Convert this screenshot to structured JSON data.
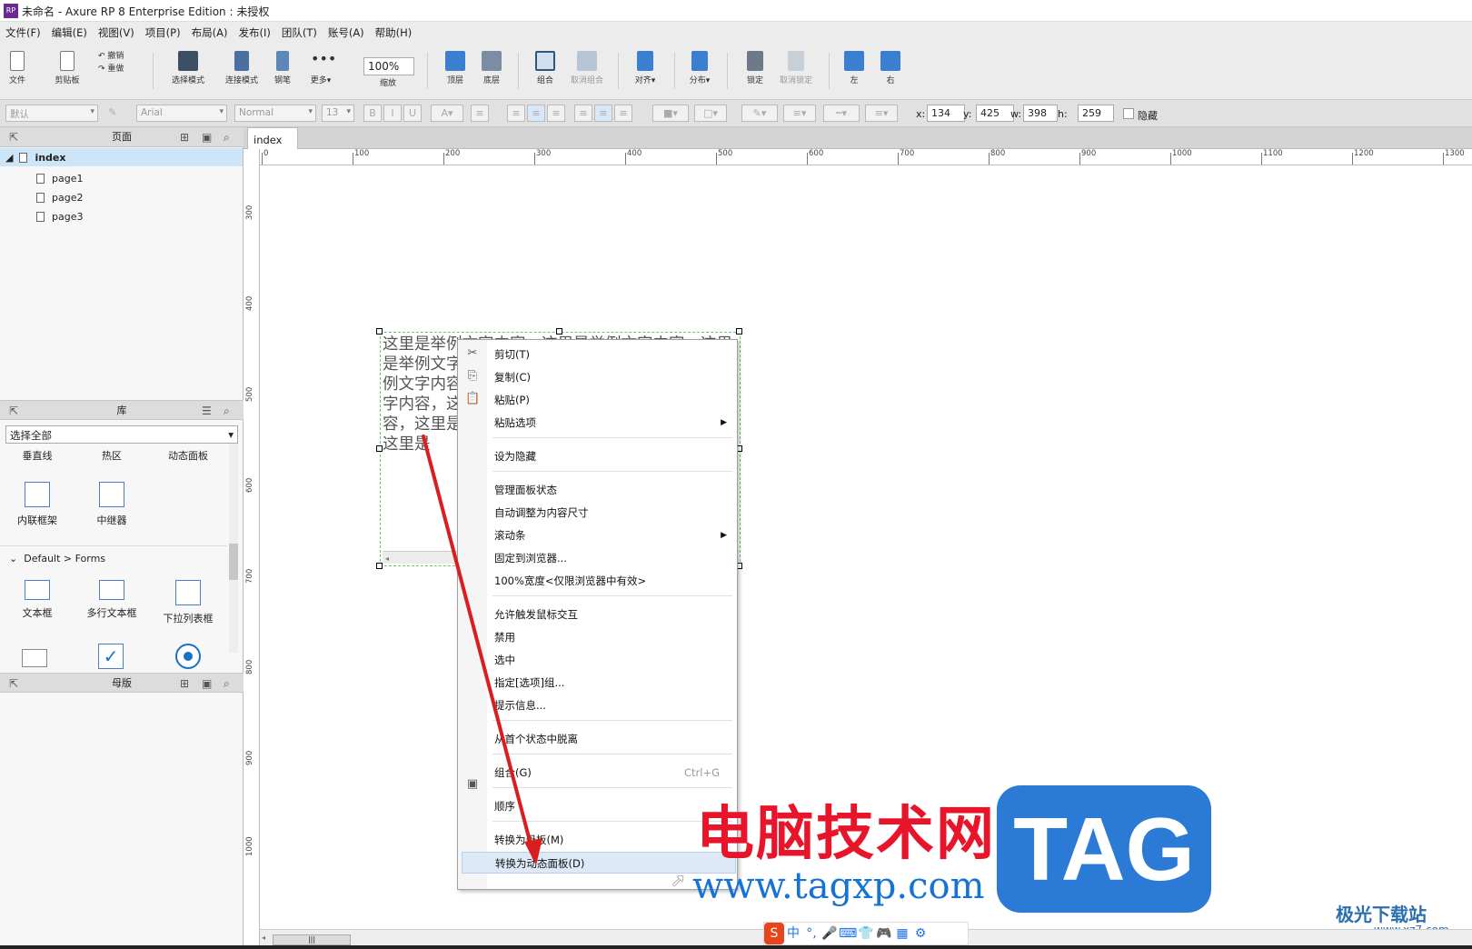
{
  "app": {
    "title": "未命名 - Axure RP 8 Enterprise Edition : 未授权",
    "logo": "RP"
  },
  "menu": [
    "文件(F)",
    "编辑(E)",
    "视图(V)",
    "项目(P)",
    "布局(A)",
    "发布(I)",
    "团队(T)",
    "账号(A)",
    "帮助(H)"
  ],
  "toolbar": {
    "file": "文件",
    "clipboard": "剪贴板",
    "undo": "撤销",
    "redo": "重做",
    "select_mode": "选择模式",
    "connect_mode": "连接模式",
    "pen": "钢笔",
    "more": "更多▾",
    "zoom": "100%",
    "zoom_label": "缩放",
    "top": "顶层",
    "bottom": "底层",
    "group": "组合",
    "ungroup": "取消组合",
    "align": "对齐▾",
    "distribute": "分布▾",
    "lock": "锁定",
    "unlock": "取消锁定",
    "left": "左",
    "right": "右"
  },
  "style": {
    "style_select": "默认",
    "font": "Arial",
    "weight": "Normal",
    "size": "13",
    "x_label": "x:",
    "x": "134",
    "y_label": "y:",
    "y": "425",
    "w_label": "w:",
    "w": "398",
    "h_label": "h:",
    "h": "259",
    "hidden_label": "隐藏"
  },
  "pages": {
    "title": "页面",
    "items": [
      "index",
      "page1",
      "page2",
      "page3"
    ]
  },
  "library": {
    "title": "库",
    "select": "选择全部",
    "row1": [
      "垂直线",
      "热区",
      "动态面板"
    ],
    "row2": [
      "内联框架",
      "中继器"
    ],
    "group": "Default > Forms",
    "row3": [
      "文本框",
      "多行文本框",
      "下拉列表框"
    ]
  },
  "masters": {
    "title": "母版"
  },
  "tab": {
    "label": "index",
    "close": "×"
  },
  "ruler": {
    "h": [
      "0",
      "100",
      "200",
      "300",
      "400",
      "500",
      "600",
      "700",
      "800",
      "900",
      "1000",
      "1100",
      "1200",
      "1300"
    ],
    "v": [
      "300",
      "400",
      "500",
      "600",
      "700",
      "800",
      "900",
      "1000"
    ]
  },
  "widget": {
    "text": "这里是举例文字内容，这里是举例文字内容，这里是举例文字内容，这里是举例文字内容，这里是举例文字内容，这里是举例文字内容，这里是举例文字内容，这里是举例文字内容，这里是举例文字内容，这里是举例文字内容，这里是举例文字内容，这里是"
  },
  "context_menu": {
    "cut": "剪切(T)",
    "copy": "复制(C)",
    "paste": "粘贴(P)",
    "paste_options": "粘贴选项",
    "set_hidden": "设为隐藏",
    "manage_states": "管理面板状态",
    "auto_fit": "自动调整为内容尺寸",
    "scrollbar": "滚动条",
    "pin": "固定到浏览器...",
    "full_width": "100%宽度<仅限浏览器中有效>",
    "allow_mouse": "允许触发鼠标交互",
    "disable": "禁用",
    "selected": "选中",
    "assign_group": "指定[选项]组...",
    "tooltip": "提示信息...",
    "break_away": "从首个状态中脱离",
    "group": "组合(G)",
    "group_shortcut": "Ctrl+G",
    "order": "顺序",
    "to_master": "转换为母板(M)",
    "to_dynamic": "转换为动态面板(D)"
  },
  "watermark": {
    "cn": "电脑技术网",
    "url": "www.tagxp.com",
    "tag": "TAG",
    "jg": "极光下载站",
    "jg_url": "www.xz7.com"
  },
  "ime": [
    "S",
    "中",
    "°,",
    "🎤",
    "⌨",
    "👕",
    "🎮",
    "▦",
    "⚙"
  ],
  "colors": {
    "arrow": "#d81e1e",
    "accent": "#2b7bd6"
  }
}
